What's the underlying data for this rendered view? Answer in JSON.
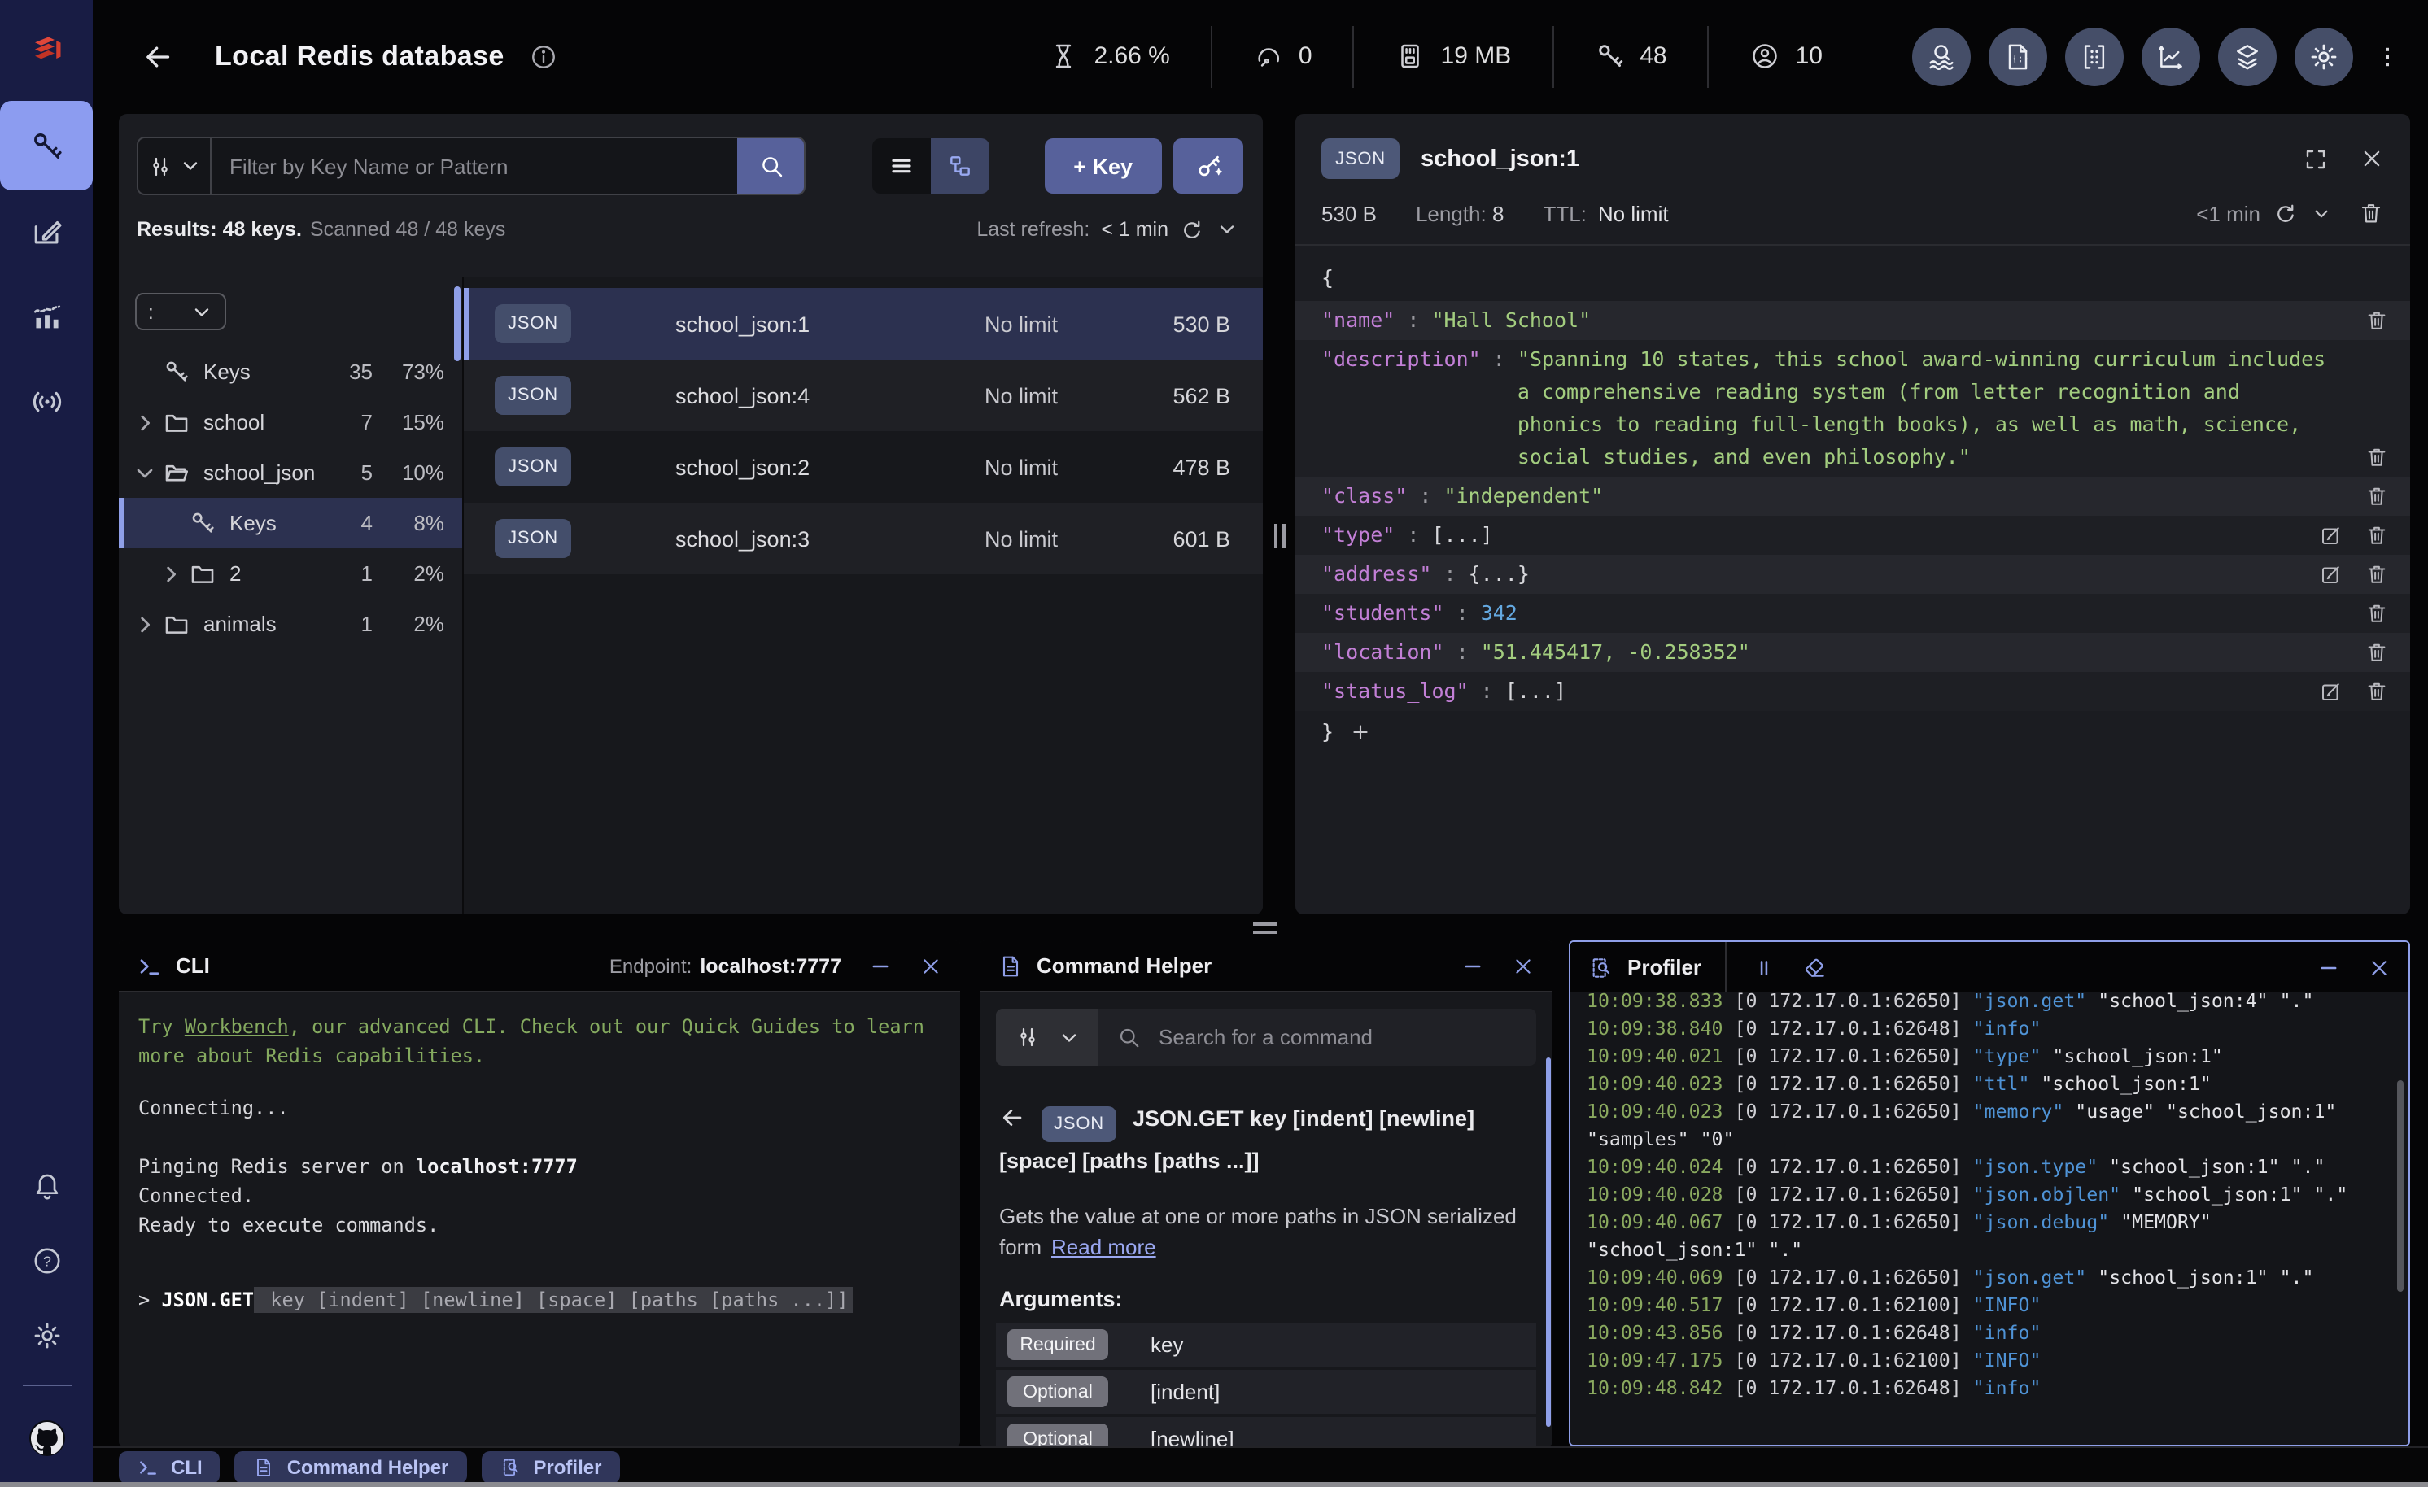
{
  "colors": {
    "accent": "#8f9fe8",
    "redis_red": "#d43d2e",
    "slate_button": "#57619b",
    "selected_row": "#2c3150",
    "json_key": "#c27fd6",
    "json_string": "#a3cd7f",
    "json_number": "#64a8e0",
    "log_time_green": "#8aa95f",
    "log_command_blue": "#4f93d6"
  },
  "header": {
    "title": "Local Redis database",
    "metrics": [
      {
        "icon": "hourglass",
        "value": "2.66 %"
      },
      {
        "icon": "gauge",
        "value": "0"
      },
      {
        "icon": "memory-card",
        "value": "19 MB"
      },
      {
        "icon": "key",
        "value": "48"
      },
      {
        "icon": "user",
        "value": "10"
      }
    ],
    "tools": [
      "wave-search",
      "json-file",
      "bulk-matrix",
      "chart-line",
      "layers",
      "gear"
    ]
  },
  "sidebar": {
    "items": [
      {
        "icon": "key",
        "name": "browser",
        "active": true
      },
      {
        "icon": "workbench",
        "name": "workbench",
        "active": false
      },
      {
        "icon": "analytics",
        "name": "analytics",
        "active": false
      },
      {
        "icon": "pubsub",
        "name": "pub-sub",
        "active": false
      }
    ],
    "bottom": [
      {
        "icon": "bell",
        "name": "notifications"
      },
      {
        "icon": "help",
        "name": "help"
      },
      {
        "icon": "gear",
        "name": "settings"
      },
      {
        "icon": "github",
        "name": "github"
      }
    ]
  },
  "browser": {
    "filter_placeholder": "Filter by Key Name or Pattern",
    "add_key_label": "+ Key",
    "results_bold": "Results: 48 keys.",
    "results_muted": "Scanned 48 / 48 keys",
    "last_refresh_label": "Last refresh:",
    "last_refresh_value": "< 1 min",
    "delimiter": ":",
    "tree": [
      {
        "icon": "key",
        "label": "Keys",
        "count": "35",
        "pct": "73%",
        "indent": 0,
        "chevron": "none",
        "selected": false
      },
      {
        "icon": "folder",
        "label": "school",
        "count": "7",
        "pct": "15%",
        "indent": 0,
        "chevron": "right",
        "selected": false
      },
      {
        "icon": "folder-open",
        "label": "school_json",
        "count": "5",
        "pct": "10%",
        "indent": 0,
        "chevron": "down",
        "selected": false
      },
      {
        "icon": "key",
        "label": "Keys",
        "count": "4",
        "pct": "8%",
        "indent": 1,
        "chevron": "none",
        "selected": true
      },
      {
        "icon": "folder",
        "label": "2",
        "count": "1",
        "pct": "2%",
        "indent": 1,
        "chevron": "right",
        "selected": false
      },
      {
        "icon": "folder",
        "label": "animals",
        "count": "1",
        "pct": "2%",
        "indent": 0,
        "chevron": "right",
        "selected": false
      }
    ],
    "keys": [
      {
        "type": "JSON",
        "name": "school_json:1",
        "ttl": "No limit",
        "size": "530 B",
        "selected": true
      },
      {
        "type": "JSON",
        "name": "school_json:4",
        "ttl": "No limit",
        "size": "562 B",
        "selected": false
      },
      {
        "type": "JSON",
        "name": "school_json:2",
        "ttl": "No limit",
        "size": "478 B",
        "selected": false
      },
      {
        "type": "JSON",
        "name": "school_json:3",
        "ttl": "No limit",
        "size": "601 B",
        "selected": false
      }
    ]
  },
  "detail": {
    "type_badge": "JSON",
    "key_name": "school_json:1",
    "size": "530 B",
    "length_label": "Length:",
    "length": "8",
    "ttl_label": "TTL:",
    "ttl": "No limit",
    "refresh_value": "<1 min",
    "open_brace": "{",
    "close_brace": "}",
    "rows": [
      {
        "key": "name",
        "value": "\"Hall School\"",
        "type": "string",
        "actions": [
          "delete"
        ]
      },
      {
        "key": "description",
        "type": "string",
        "actions": [
          "delete"
        ],
        "lines": [
          "\"Spanning 10 states, this school award-winning curriculum includes",
          "a comprehensive reading system (from letter recognition and",
          "phonics to reading full-length books), as well as math, science,",
          "social studies, and even philosophy.\""
        ]
      },
      {
        "key": "class",
        "value": "\"independent\"",
        "type": "string",
        "actions": [
          "delete"
        ]
      },
      {
        "key": "type",
        "value": "[...]",
        "type": "collapsed",
        "actions": [
          "edit",
          "delete"
        ]
      },
      {
        "key": "address",
        "value": "{...}",
        "type": "collapsed",
        "actions": [
          "edit",
          "delete"
        ]
      },
      {
        "key": "students",
        "value": "342",
        "type": "number",
        "actions": [
          "delete"
        ]
      },
      {
        "key": "location",
        "value": "\"51.445417, -0.258352\"",
        "type": "string",
        "actions": [
          "delete"
        ]
      },
      {
        "key": "status_log",
        "value": "[...]",
        "type": "collapsed",
        "actions": [
          "edit",
          "delete"
        ]
      }
    ]
  },
  "cli": {
    "title": "CLI",
    "endpoint_label": "Endpoint:",
    "endpoint": "localhost:7777",
    "tip_pre": "Try ",
    "tip_link": "Workbench",
    "tip_post": ", our advanced CLI. Check out our Quick Guides to learn more about Redis capabilities.",
    "connecting": "Connecting...",
    "pinging_pre": "Pinging Redis server on ",
    "pinging_endpoint": "localhost:7777",
    "connected": "Connected.",
    "ready": "Ready to execute commands.",
    "prompt": "> ",
    "prompt_cmd": "JSON.GET",
    "prompt_hint": " key [indent] [newline] [space] [paths [paths ...]]"
  },
  "helper": {
    "title": "Command Helper",
    "search_placeholder": "Search for a command",
    "badge": "JSON",
    "syntax": "JSON.GET key [indent] [newline] [space] [paths [paths ...]]",
    "summary": "Gets the value at one or more paths in JSON serialized form",
    "read_more": "Read more",
    "arguments_label": "Arguments:",
    "args": [
      {
        "badge": "Required",
        "name": "key"
      },
      {
        "badge": "Optional",
        "name": "[indent]"
      },
      {
        "badge": "Optional",
        "name": "[newline]"
      }
    ]
  },
  "profiler": {
    "title": "Profiler",
    "lines": [
      {
        "time": "10:09:38.833",
        "client": "[0 172.17.0.1:62650]",
        "cmd": "\"json.get\"",
        "args": " \"school_json:4\" \".\"",
        "partial": true
      },
      {
        "time": "10:09:38.840",
        "client": "[0 172.17.0.1:62648]",
        "cmd": "\"info\"",
        "args": ""
      },
      {
        "time": "10:09:40.021",
        "client": "[0 172.17.0.1:62650]",
        "cmd": "\"type\"",
        "args": " \"school_json:1\""
      },
      {
        "time": "10:09:40.023",
        "client": "[0 172.17.0.1:62650]",
        "cmd": "\"ttl\"",
        "args": " \"school_json:1\""
      },
      {
        "time": "10:09:40.023",
        "client": "[0 172.17.0.1:62650]",
        "cmd": "\"memory\"",
        "args": " \"usage\" \"school_json:1\" \"samples\" \"0\""
      },
      {
        "time": "10:09:40.024",
        "client": "[0 172.17.0.1:62650]",
        "cmd": "\"json.type\"",
        "args": " \"school_json:1\" \".\""
      },
      {
        "time": "10:09:40.028",
        "client": "[0 172.17.0.1:62650]",
        "cmd": "\"json.objlen\"",
        "args": " \"school_json:1\" \".\""
      },
      {
        "time": "10:09:40.067",
        "client": "[0 172.17.0.1:62650]",
        "cmd": "\"json.debug\"",
        "args": " \"MEMORY\" \"school_json:1\" \".\""
      },
      {
        "time": "10:09:40.069",
        "client": "[0 172.17.0.1:62650]",
        "cmd": "\"json.get\"",
        "args": " \"school_json:1\" \".\""
      },
      {
        "time": "10:09:40.517",
        "client": "[0 172.17.0.1:62100]",
        "cmd": "\"INFO\"",
        "args": ""
      },
      {
        "time": "10:09:43.856",
        "client": "[0 172.17.0.1:62648]",
        "cmd": "\"info\"",
        "args": ""
      },
      {
        "time": "10:09:47.175",
        "client": "[0 172.17.0.1:62100]",
        "cmd": "\"INFO\"",
        "args": ""
      },
      {
        "time": "10:09:48.842",
        "client": "[0 172.17.0.1:62648]",
        "cmd": "\"info\"",
        "args": ""
      }
    ]
  },
  "tabs": [
    {
      "icon": "terminal",
      "label": "CLI"
    },
    {
      "icon": "document",
      "label": "Command Helper"
    },
    {
      "icon": "profiler",
      "label": "Profiler"
    }
  ]
}
